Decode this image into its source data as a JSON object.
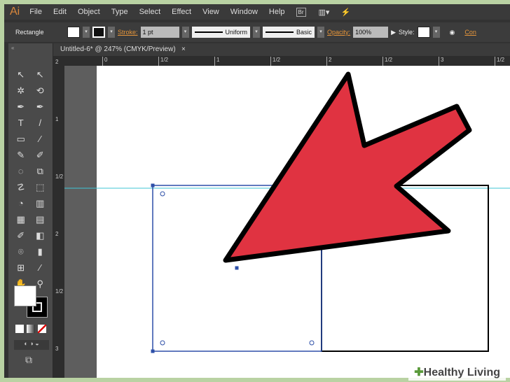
{
  "menu": {
    "logo": "Ai",
    "items": [
      "File",
      "Edit",
      "Object",
      "Type",
      "Select",
      "Effect",
      "View",
      "Window",
      "Help"
    ],
    "bridge": "Br"
  },
  "control": {
    "tool": "Rectangle",
    "stroke_label": "Stroke:",
    "stroke_value": "1 pt",
    "profile": "Uniform",
    "brush": "Basic",
    "opacity_label": "Opacity:",
    "opacity_value": "100%",
    "style_label": "Style:",
    "extra": "Con"
  },
  "document": {
    "tab": "Untitled-6* @ 247% (CMYK/Preview)",
    "close": "×"
  },
  "ruler": {
    "h": [
      "0",
      "1/2",
      "1",
      "1/2",
      "2",
      "1/2",
      "3",
      "1/2"
    ],
    "v": [
      "2",
      "1",
      "1/2",
      "2",
      "1/2",
      "3"
    ]
  },
  "tools": [
    "↖",
    "↖",
    "✲",
    "⟲",
    "✒",
    "✒",
    "T",
    "/",
    "▭",
    "⁄",
    "✎",
    "✐",
    "◌",
    "⧉",
    "☡",
    "⬚",
    "◔",
    "▥",
    "▦",
    "▤",
    "✐",
    "◧",
    "⌾",
    "▮",
    "⊞",
    "⁄",
    "✋",
    "⚲"
  ],
  "watermark": "Healthy Living",
  "colors": {
    "arrow": "#e03341",
    "guide": "#3fc6d6",
    "selection": "#2d4fa8"
  }
}
